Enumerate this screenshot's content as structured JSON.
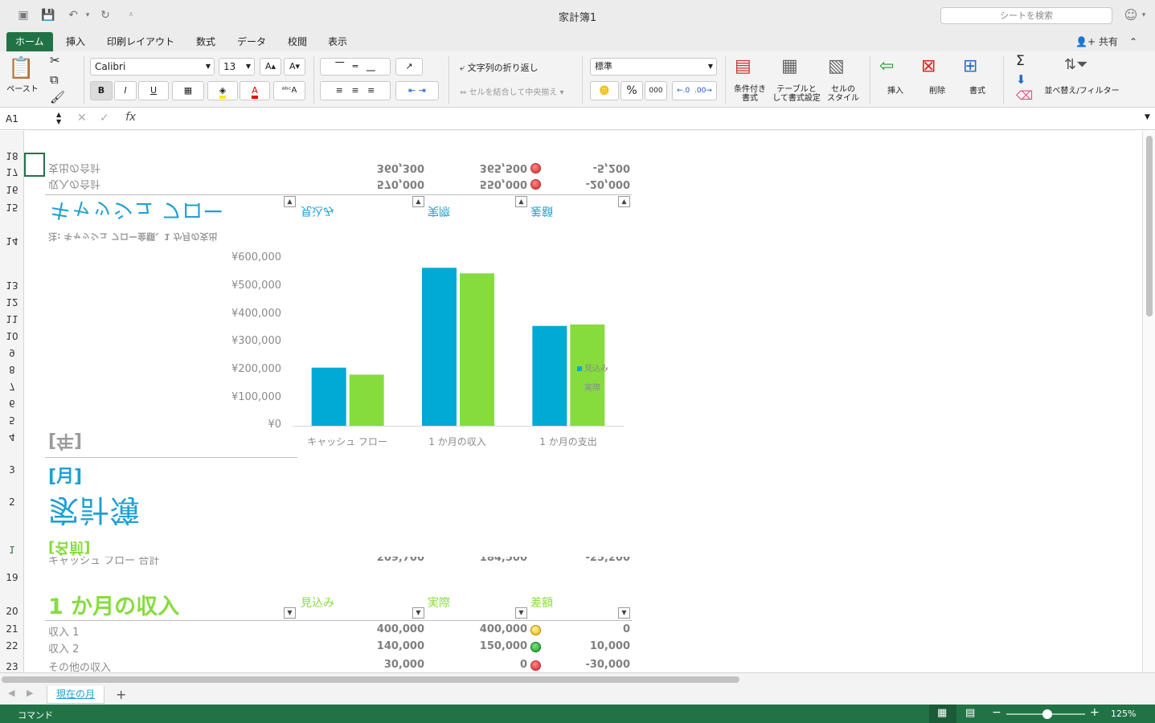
{
  "window": {
    "title": "家計簿1",
    "search_placeholder": "シートを検索"
  },
  "tabs": [
    "ホーム",
    "挿入",
    "印刷レイアウト",
    "数式",
    "データ",
    "校閲",
    "表示"
  ],
  "share_label": "共有",
  "ribbon": {
    "paste": "ペースト",
    "font_name": "Calibri",
    "font_size": "13",
    "wrap_text": "文字列の折り返し",
    "merge_center": "セルを結合して中央揃え",
    "number_format": "標準",
    "percent": "%",
    "thousands": "000",
    "conditional": "条件付き\n書式",
    "table_format": "テーブルと\nして書式設定",
    "cell_style": "セルの\nスタイル",
    "insert": "挿入",
    "delete": "削除",
    "format": "書式",
    "sort_filter": "並べ替え/フィルター",
    "bold": "B",
    "italic": "I",
    "underline": "U"
  },
  "formula_bar": {
    "name_box": "A1",
    "fx": "fx",
    "formula": ""
  },
  "rows": {
    "top": [
      "18",
      "17",
      "16",
      "15",
      "14",
      "13",
      "12",
      "11",
      "10",
      "9",
      "8",
      "7",
      "6",
      "5",
      "4",
      "3",
      "2",
      "1"
    ],
    "bottom": [
      "19",
      "20",
      "21",
      "22",
      "23"
    ]
  },
  "mirrored": {
    "r17": {
      "label": "支出の合計",
      "expected": "360,300",
      "actual": "365,500",
      "diff": "-5,200",
      "status": "red"
    },
    "r16": {
      "label": "収入の合計",
      "expected": "570,000",
      "actual": "550,000",
      "diff": "-20,000",
      "status": "red"
    },
    "r15": {
      "title": "キャッシュ フロー",
      "col1": "見込み",
      "col2": "実際",
      "col3": "差額"
    },
    "r14": {
      "note": "注: キャッシュ フロー金額、1 か月の支出"
    },
    "r4": "[年]",
    "r3": "[月]",
    "r2": "家計簿",
    "r1": "[名前]"
  },
  "row18_partial": {
    "label": "キャッシュ フロー 合計",
    "expected": "209,700",
    "actual": "184,500",
    "diff": "-25,200"
  },
  "income_section": {
    "title": "1 か月の収入",
    "headers": [
      "見込み",
      "実際",
      "差額"
    ],
    "rows": [
      {
        "label": "収入 1",
        "expected": "400,000",
        "actual": "400,000",
        "diff": "0",
        "status": "yellow"
      },
      {
        "label": "収入 2",
        "expected": "140,000",
        "actual": "150,000",
        "diff": "10,000",
        "status": "green"
      },
      {
        "label": "その他の収入",
        "expected": "30,000",
        "actual": "0",
        "diff": "-30,000",
        "status": "red"
      }
    ]
  },
  "chart_data": {
    "type": "bar",
    "categories": [
      "キャッシュ フロー",
      "1 か月の収入",
      "1 か月の支出"
    ],
    "series": [
      {
        "name": "見込み",
        "color": "#00aad4",
        "values": [
          209700,
          570000,
          360300
        ]
      },
      {
        "name": "実際",
        "color": "#86dc3d",
        "values": [
          184500,
          550000,
          365500
        ]
      }
    ],
    "yticks": [
      "¥600,000",
      "¥500,000",
      "¥400,000",
      "¥300,000",
      "¥200,000",
      "¥100,000",
      "¥0"
    ],
    "ylim": [
      0,
      600000
    ],
    "legend_position": "top-right"
  },
  "sheet": {
    "tab": "現在の月",
    "add": "+"
  },
  "status": {
    "mode": "コマンド",
    "zoom": "125%"
  },
  "colors": {
    "accent_green": "#217346",
    "teal": "#1e9fd3",
    "lime": "#86dc3d"
  }
}
